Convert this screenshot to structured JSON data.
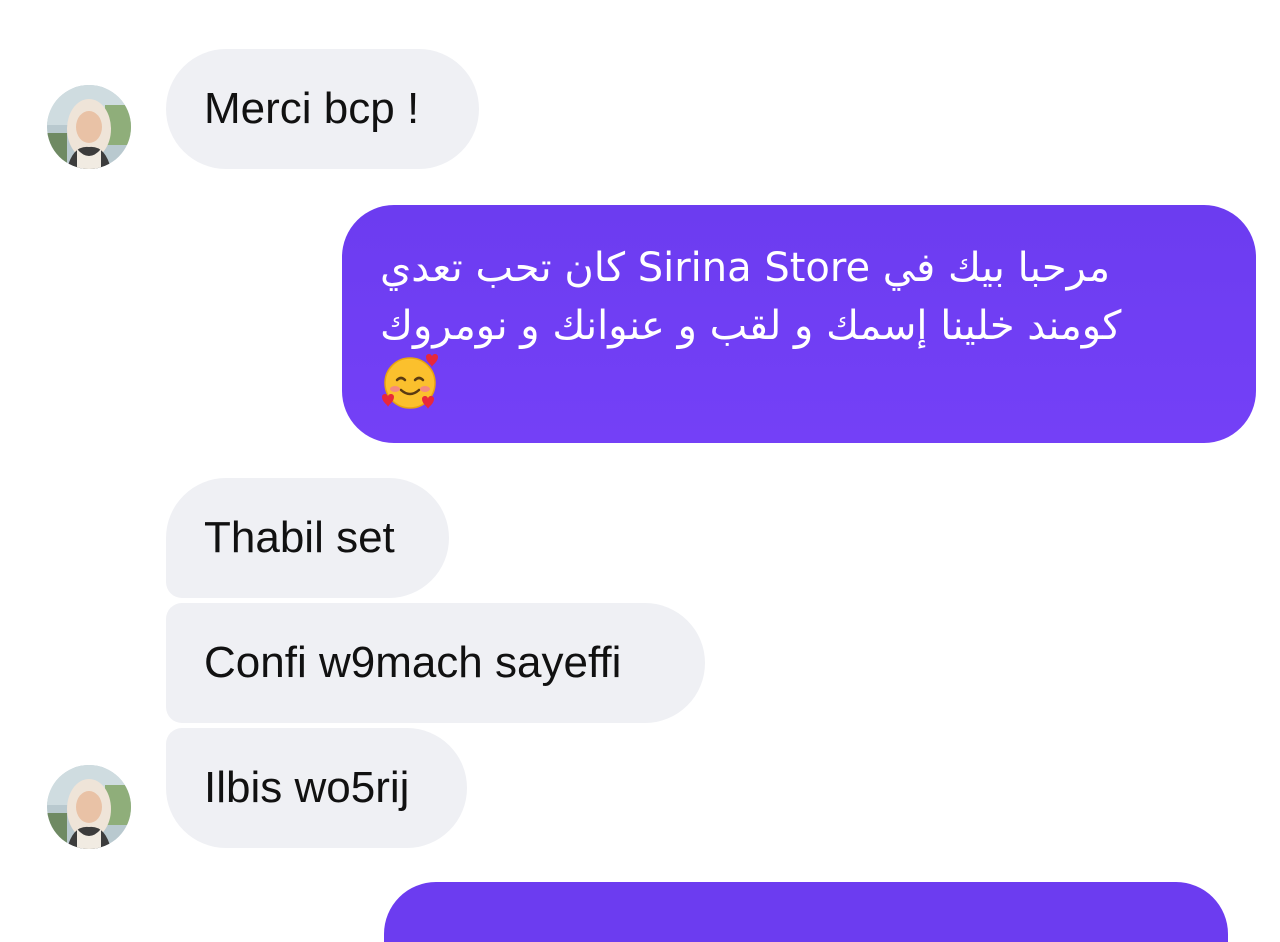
{
  "conversation": {
    "messages": [
      {
        "id": "m1",
        "direction": "incoming",
        "text": "Merci bcp !"
      },
      {
        "id": "m2",
        "direction": "outgoing",
        "lines": [
          "مرحبا بيك في Sirina Store كان تحب تعدي",
          "كومند خلينا إسمك و لقب و عنوانك و نومروك"
        ],
        "emoji": "smiling-face-with-hearts-icon"
      },
      {
        "id": "m3",
        "direction": "incoming",
        "text": "Thabil set"
      },
      {
        "id": "m4",
        "direction": "incoming",
        "text": "Confi w9mach sayeffi"
      },
      {
        "id": "m5",
        "direction": "incoming",
        "text": "Ilbis wo5rij"
      }
    ]
  },
  "colors": {
    "incoming_bubble": "#eff0f4",
    "outgoing_bubble": "#6d3cf3",
    "incoming_text": "#111111",
    "outgoing_text": "#ffffff"
  }
}
